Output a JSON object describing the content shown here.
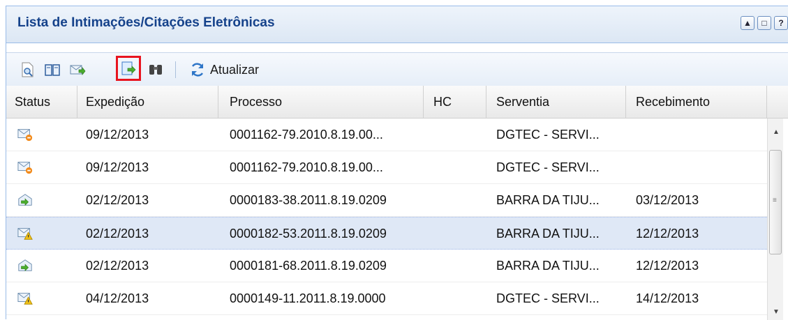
{
  "panel": {
    "title": "Lista de Intimações/Citações Eletrônicas",
    "tools": [
      "▲",
      "□",
      "?"
    ]
  },
  "toolbar": {
    "refresh_label": "Atualizar",
    "icons": [
      "view-document-icon",
      "open-book-icon",
      "mail-forward-icon",
      "export-forward-icon",
      "binoculars-icon",
      "refresh-icon"
    ]
  },
  "grid": {
    "columns": [
      "Status",
      "Expedição",
      "Processo",
      "HC",
      "Serventia",
      "Recebimento"
    ],
    "rows": [
      {
        "status": "pending-mail-icon",
        "expedicao": "09/12/2013",
        "processo": "0001162-79.2010.8.19.00...",
        "hc": "",
        "serventia": "DGTEC - SERVI...",
        "recebimento": ""
      },
      {
        "status": "pending-mail-icon",
        "expedicao": "09/12/2013",
        "processo": "0001162-79.2010.8.19.00...",
        "hc": "",
        "serventia": "DGTEC - SERVI...",
        "recebimento": ""
      },
      {
        "status": "received-mail-icon",
        "expedicao": "02/12/2013",
        "processo": "0000183-38.2011.8.19.0209",
        "hc": "",
        "serventia": "BARRA DA TIJU...",
        "recebimento": "03/12/2013"
      },
      {
        "status": "warning-mail-icon",
        "expedicao": "02/12/2013",
        "processo": "0000182-53.2011.8.19.0209",
        "hc": "",
        "serventia": "BARRA DA TIJU...",
        "recebimento": "12/12/2013"
      },
      {
        "status": "received-mail-icon",
        "expedicao": "02/12/2013",
        "processo": "0000181-68.2011.8.19.0209",
        "hc": "",
        "serventia": "BARRA DA TIJU...",
        "recebimento": "12/12/2013"
      },
      {
        "status": "warning-mail-icon",
        "expedicao": "04/12/2013",
        "processo": "0000149-11.2011.8.19.0000",
        "hc": "",
        "serventia": "DGTEC - SERVI...",
        "recebimento": "14/12/2013"
      }
    ],
    "selected_row": 3
  }
}
